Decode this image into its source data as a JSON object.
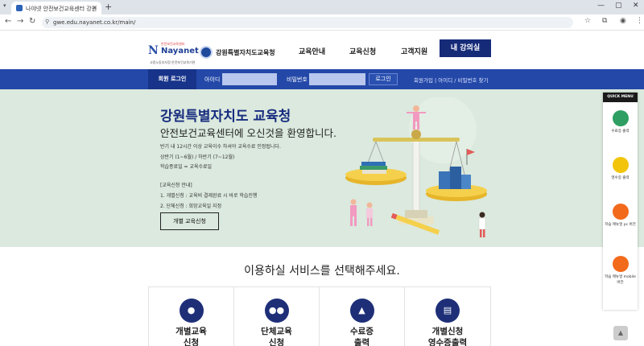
{
  "browser": {
    "tab_title": "나야넷 안전보건교육센터 강원",
    "url": "gwe.edu.nayanet.co.kr/main/"
  },
  "header": {
    "logo_main": "Nayanet",
    "logo_small": "안전보건교육센터",
    "logo_sub": "고용노동부지정 안전보건교육기관",
    "partner": "강원특별자치도교육청",
    "menu": [
      "교육안내",
      "교육신청",
      "고객지원"
    ],
    "my_class": "내 강의실"
  },
  "login": {
    "title": "회원 로그인",
    "id_label": "아이디",
    "pw_label": "비밀번호",
    "login_button": "로그인",
    "links": "회원가입  |  아이디 / 비밀번호 찾기"
  },
  "hero": {
    "title": "강원특별자치도 교육청",
    "subtitle": "안전보건교육센터에 오신것을 환영합니다.",
    "lines": [
      "반기 내 12시간 이상 교육이수 하셔야 교육수료 인정됩니다.",
      "상반기 (1~6월) / 하반기 (7~12월)",
      "학습종료일 = 교육수료일",
      "[교육신청 안내]",
      "1. 개별신청 : 교육비 결제완료 시 바로 학습진행",
      "2. 단체신청 : 희망교육일 지정"
    ],
    "apply_button": "개별 교육신청"
  },
  "quick_menu": {
    "title": "QUICK MENU",
    "items": [
      {
        "label": "수료증 출력",
        "color": "#2e9e62"
      },
      {
        "label": "영수증 출력",
        "color": "#f2c40c"
      },
      {
        "label": "학습 매뉴얼 pc 버전",
        "color": "#f26a1b"
      },
      {
        "label": "학습 매뉴얼 mobile 버전",
        "color": "#f26a1b"
      }
    ]
  },
  "services": {
    "title": "이용하실 서비스를 선택해주세요.",
    "items": [
      {
        "label": "개별교육\n신청",
        "icon": "user-icon"
      },
      {
        "label": "단체교육\n신청",
        "icon": "group-icon"
      },
      {
        "label": "수료증\n출력",
        "icon": "graduation-cap-icon"
      },
      {
        "label": "개별신청\n영수증출력",
        "icon": "document-icon"
      }
    ]
  },
  "colors": {
    "navy": "#162b78",
    "login_bar": "#2348a8",
    "hero_bg": "#dbe9de"
  }
}
